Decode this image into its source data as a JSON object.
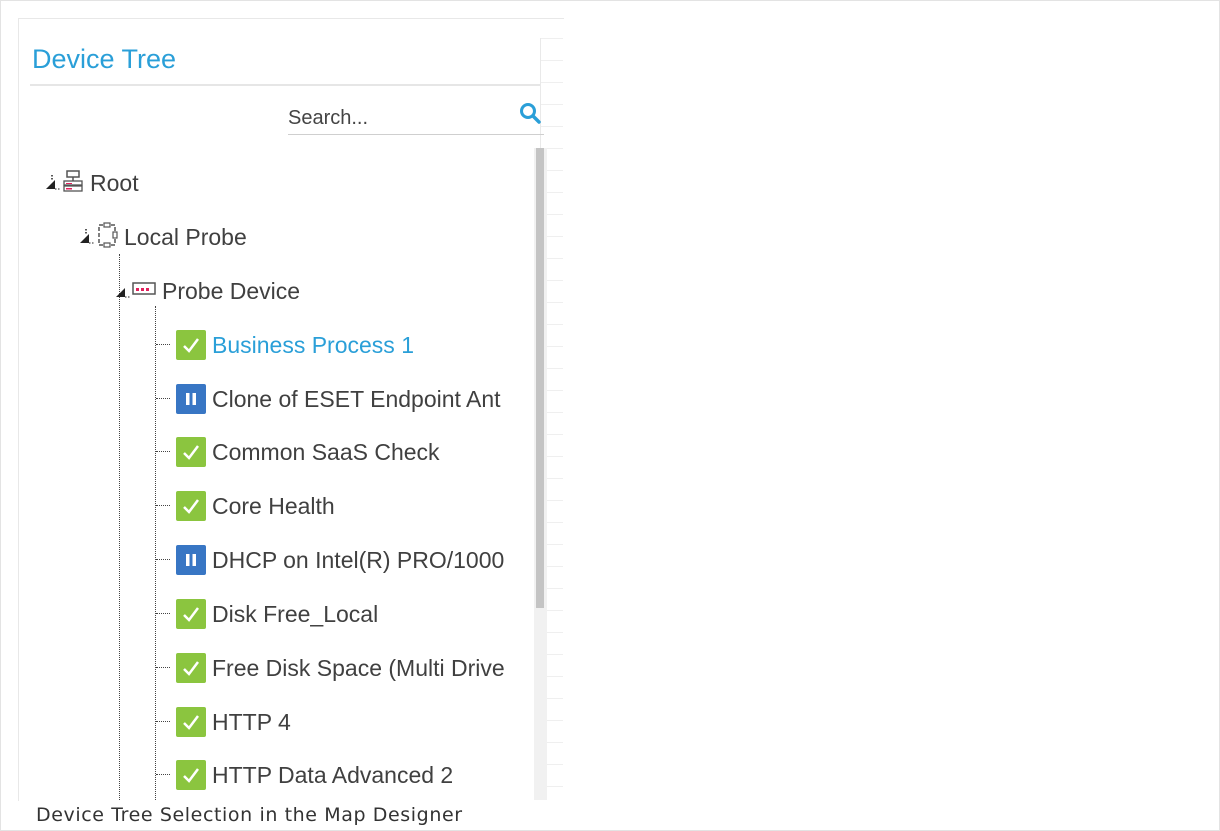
{
  "panel": {
    "title": "Device Tree",
    "search": {
      "placeholder": "Search..."
    }
  },
  "tree": {
    "root": {
      "label": "Root"
    },
    "probe": {
      "label": "Local Probe"
    },
    "device": {
      "label": "Probe Device"
    },
    "sensors": [
      {
        "label": "Business Process 1",
        "status": "ok",
        "selected": true
      },
      {
        "label": "Clone of ESET Endpoint Ant",
        "status": "paused"
      },
      {
        "label": "Common SaaS Check",
        "status": "ok"
      },
      {
        "label": "Core Health",
        "status": "ok"
      },
      {
        "label": "DHCP on Intel(R) PRO/1000",
        "status": "paused"
      },
      {
        "label": "Disk Free_Local",
        "status": "ok"
      },
      {
        "label": "Free Disk Space (Multi Drive",
        "status": "ok"
      },
      {
        "label": "HTTP 4",
        "status": "ok"
      },
      {
        "label": "HTTP Data Advanced 2",
        "status": "ok"
      }
    ]
  },
  "colors": {
    "accent": "#2a9fd8",
    "ok": "#8bc53f",
    "paused": "#3876c4"
  },
  "icons": {
    "ok": "checkmark-icon",
    "paused": "pause-icon"
  },
  "caption": "Device Tree Selection in the Map Designer"
}
